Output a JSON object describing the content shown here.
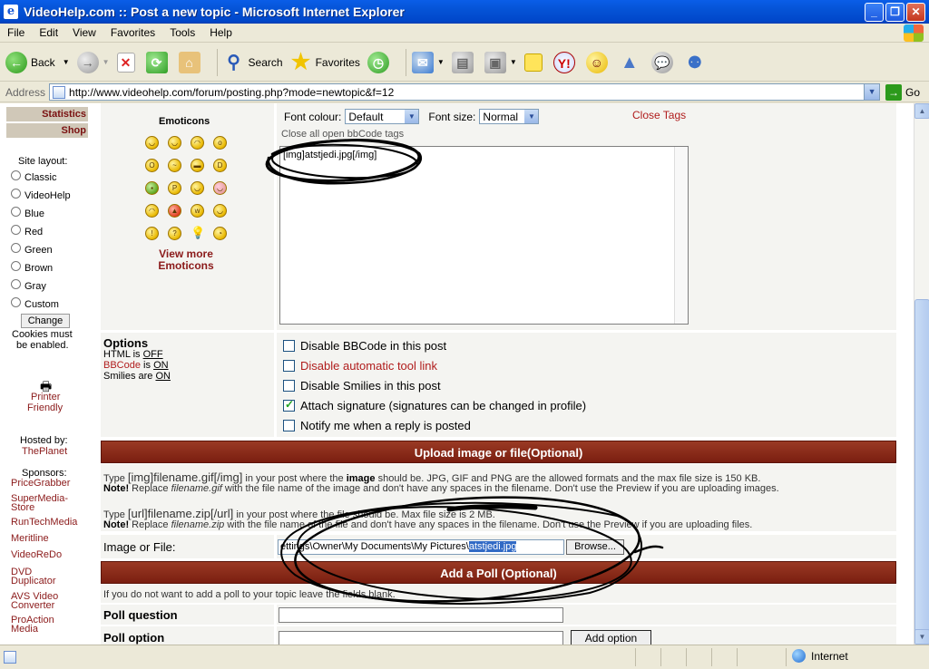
{
  "window": {
    "title": "VideoHelp.com :: Post a new topic - Microsoft Internet Explorer"
  },
  "menu": [
    "File",
    "Edit",
    "View",
    "Favorites",
    "Tools",
    "Help"
  ],
  "toolbar": {
    "back": "Back",
    "search": "Search",
    "favorites": "Favorites"
  },
  "address": {
    "label": "Address",
    "url": "http://www.videohelp.com/forum/posting.php?mode=newtopic&f=12",
    "go": "Go"
  },
  "sidebar": {
    "links": [
      "Statistics",
      "Shop"
    ],
    "layout_label": "Site layout:",
    "layouts": [
      "Classic",
      "VideoHelp",
      "Blue",
      "Red",
      "Green",
      "Brown",
      "Gray",
      "Custom"
    ],
    "change_button": "Change",
    "cookies_note_1": "Cookies must",
    "cookies_note_2": "be enabled.",
    "printer_1": "Printer",
    "printer_2": "Friendly",
    "hosted_label": "Hosted by:",
    "hosted_name": "ThePlanet",
    "sponsors_label": "Sponsors:",
    "sponsors": [
      [
        "PriceGrabber"
      ],
      [
        "SuperMedia-",
        "Store"
      ],
      [
        "RunTechMedia"
      ],
      [
        "Meritline"
      ],
      [
        "VideoReDo"
      ],
      [
        "DVD",
        "Duplicator"
      ],
      [
        "AVS Video",
        "Converter"
      ],
      [
        "ProAction",
        "Media"
      ]
    ]
  },
  "emoticons": {
    "title": "Emoticons",
    "view_more_1": "View more",
    "view_more_2": "Emoticons"
  },
  "editor": {
    "font_colour_label": "Font colour:",
    "font_colour_value": "Default",
    "font_size_label": "Font size:",
    "font_size_value": "Normal",
    "close_tags": "Close Tags",
    "bbcode_hint": "Close all open bbCode tags",
    "message": "[img]atstjedi.jpg[/img]"
  },
  "options": {
    "title": "Options",
    "html_label": "HTML is",
    "html_value": "OFF",
    "bbcode_label": "BBCode",
    "bbcode_is": "is",
    "bbcode_value": "ON",
    "smilies_label": "Smilies are",
    "smilies_value": "ON",
    "checkboxes": [
      {
        "label": "Disable BBCode in this post",
        "checked": false
      },
      {
        "label": "Disable automatic tool link",
        "checked": false
      },
      {
        "label": "Disable Smilies in this post",
        "checked": false
      },
      {
        "label": "Attach signature (signatures can be changed in profile)",
        "checked": true
      },
      {
        "label": "Notify me when a reply is posted",
        "checked": false
      }
    ]
  },
  "upload": {
    "header": "Upload image or file(Optional)",
    "line1_pre": "Type",
    "line1_tag": "[img]filename.gif[/img]",
    "line1_mid": "in your post where the",
    "line1_bold": "image",
    "line1_post": "should be. JPG, GIF and PNG are the allowed formats and the max file size is 150 KB.",
    "line2_note": "Note!",
    "line2_pre": "Replace",
    "line2_file": "filename.gif",
    "line2_post": "with the file name of the image and don't have any spaces in the filename. Don't use the Preview if you are uploading images.",
    "line3_pre": "Type",
    "line3_tag": "[url]filename.zip[/url]",
    "line3_post": "in your post where the file should be. Max file size is 2 MB.",
    "line4_note": "Note!",
    "line4_pre": "Replace",
    "line4_file": "filename.zip",
    "line4_post": "with the file name of the file and don't have any spaces in the filename. Don't use the Preview if you are uploading files.",
    "file_label": "Image or File:",
    "file_path": "ettings\\Owner\\My Documents\\My Pictures\\",
    "file_selected": "atstjedi.jpg",
    "browse": "Browse..."
  },
  "poll": {
    "header": "Add a Poll (Optional)",
    "hint": "If you do not want to add a poll to your topic leave the fields blank.",
    "question_label": "Poll question",
    "option_label": "Poll option",
    "add_option": "Add option"
  },
  "status": {
    "zone": "Internet"
  }
}
